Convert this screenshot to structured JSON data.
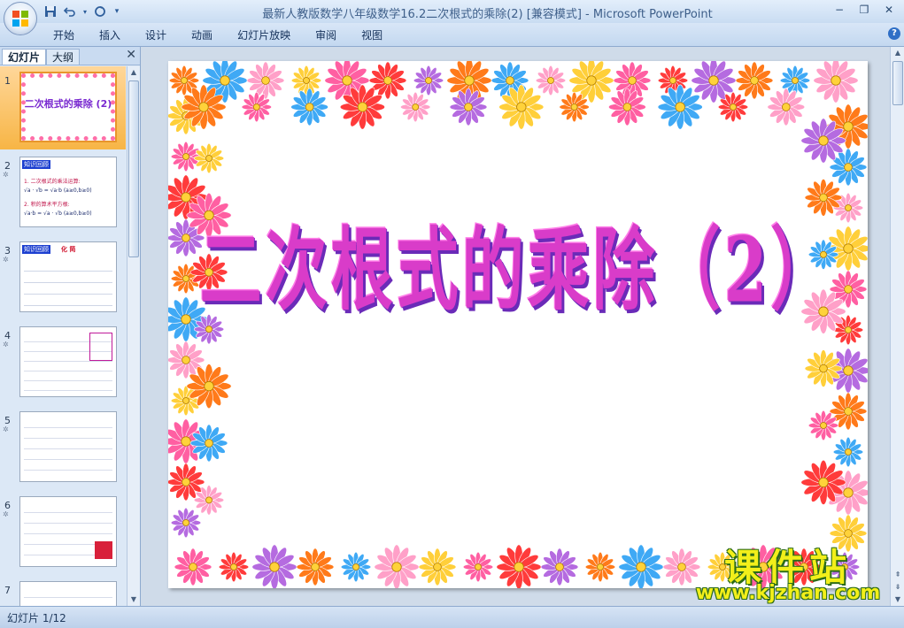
{
  "app": {
    "window_title": "最新人教版数学八年级数学16.2二次根式的乘除(2) [兼容模式] - Microsoft PowerPoint",
    "quick_access": {
      "save_icon": "save-icon",
      "undo_icon": "undo-icon",
      "redo_icon": "redo-icon",
      "customize_icon": "chevron-down-icon"
    },
    "window_controls": {
      "minimize": "−",
      "restore": "❐",
      "close": "✕"
    }
  },
  "ribbon": {
    "tabs": [
      {
        "label": "开始"
      },
      {
        "label": "插入"
      },
      {
        "label": "设计"
      },
      {
        "label": "动画"
      },
      {
        "label": "幻灯片放映"
      },
      {
        "label": "审阅"
      },
      {
        "label": "视图"
      }
    ],
    "help_label": "?"
  },
  "slide_pane": {
    "tabs": {
      "slides": "幻灯片",
      "outline": "大纲"
    },
    "close_label": "✕",
    "thumbnails": [
      {
        "number": "1",
        "title": "二次根式的乘除 (2)",
        "selected": true
      },
      {
        "number": "2",
        "title": "知识回顾",
        "lines": [
          "1. 二次根式的乘法运算:",
          "√a · √b = √a·b (a≥0,b≥0)",
          "2. 积的算术平方根:",
          "√a·b = √a · √b (a≥0,b≥0)"
        ]
      },
      {
        "number": "3",
        "title": "知识回顾",
        "subtitle": "化 简"
      },
      {
        "number": "4"
      },
      {
        "number": "5"
      },
      {
        "number": "6"
      },
      {
        "number": "7"
      }
    ]
  },
  "slide": {
    "title": "二次根式的乘除（2）",
    "border_colors": [
      "#ff7a1a",
      "#ff5fa2",
      "#3fa9f5",
      "#ff3b3b",
      "#ffa0c8",
      "#b56be0",
      "#ffcf3a"
    ]
  },
  "status": {
    "slide_counter": "幻灯片 1/12"
  },
  "watermark": {
    "chinese": "课件站",
    "url": "www.kjzhan.com"
  }
}
